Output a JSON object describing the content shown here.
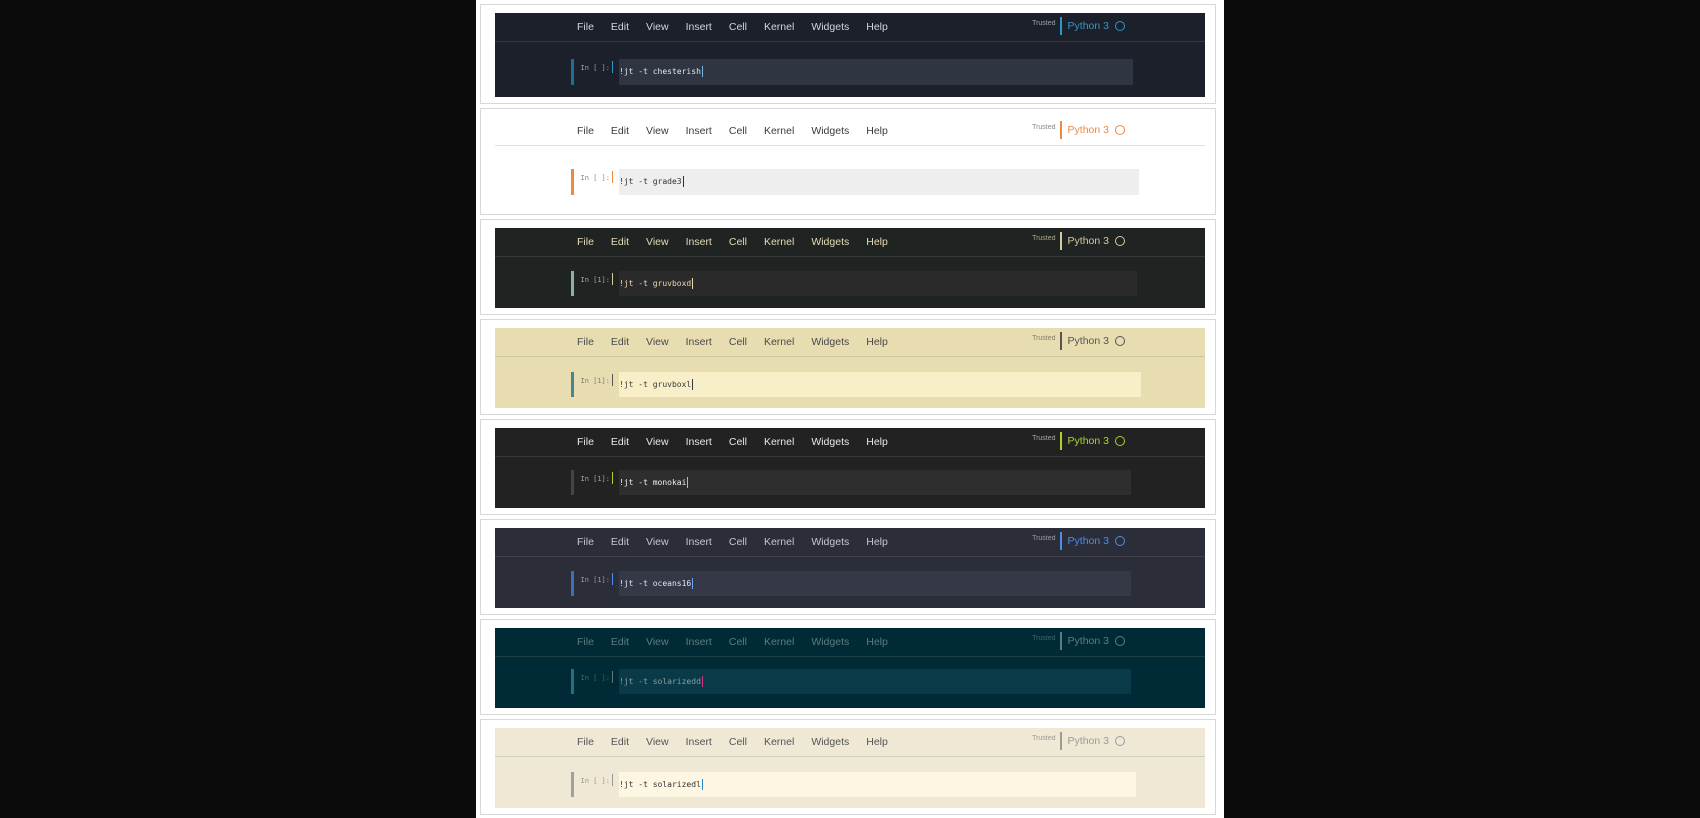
{
  "menu": [
    "File",
    "Edit",
    "View",
    "Insert",
    "Cell",
    "Kernel",
    "Widgets",
    "Help"
  ],
  "trusted_label": "Trusted",
  "kernel_label": "Python 3",
  "themes": [
    {
      "id": "chesterish",
      "prompt": "In [ ]:",
      "command": "!jt -t chesterish",
      "colors": {
        "bg": "#1c202b",
        "cell": "#303542",
        "text": "#d1d5dd",
        "menu": "#d1d5dd",
        "accent": "#2e97c9",
        "border": "#1f6e96",
        "code": "#e2e6ee",
        "cursor": "#6fb8e0"
      }
    },
    {
      "id": "grade3",
      "prompt": "In [ ]:",
      "command": "!jt -t grade3",
      "colors": {
        "bg": "#ffffff",
        "cell": "#eeeeee",
        "text": "#555555",
        "menu": "#3a3a3a",
        "accent": "#f0883e",
        "border": "#f0883e",
        "code": "#303030",
        "cursor": "#303030"
      }
    },
    {
      "id": "gruvboxd",
      "prompt": "In [1]:",
      "command": "!jt -t gruvboxd",
      "colors": {
        "bg": "#1f2422",
        "cell": "#2a2a2a",
        "text": "#e5dcb6",
        "menu": "#e5dcb6",
        "accent": "#d6c99e",
        "border": "#8fb0a0",
        "code": "#ebdbb2",
        "cursor": "#ebdbb2"
      }
    },
    {
      "id": "gruvboxl",
      "prompt": "In [1]:",
      "command": "!jt -t gruvboxl",
      "colors": {
        "bg": "#e8dcb1",
        "cell": "#f8efc8",
        "text": "#5a544a",
        "menu": "#4a4a4a",
        "accent": "#555555",
        "border": "#46878d",
        "code": "#3a3a3a",
        "cursor": "#3a3a3a"
      }
    },
    {
      "id": "monokai",
      "prompt": "In [1]:",
      "command": "!jt -t monokai",
      "colors": {
        "bg": "#222222",
        "cell": "#2e2e2e",
        "text": "#dddddd",
        "menu": "#e8e8e8",
        "accent": "#a6d62c",
        "border": "#444444",
        "code": "#f0f0f0",
        "cursor": "#66d9ef"
      }
    },
    {
      "id": "oceans16",
      "prompt": "In [1]:",
      "command": "!jt -t oceans16",
      "colors": {
        "bg": "#2b2d38",
        "cell": "#353846",
        "text": "#c4c6cf",
        "menu": "#c4c6cf",
        "accent": "#4c8ee8",
        "border": "#3b6fb8",
        "code": "#e4e6ee",
        "cursor": "#6ba6f4"
      }
    },
    {
      "id": "solarizedd",
      "prompt": "In [ ]:",
      "command": "!jt -t solarizedd",
      "colors": {
        "bg": "#002b36",
        "cell": "#0a3a47",
        "text": "#5e7b82",
        "menu": "#5e7b82",
        "accent": "#5e7b82",
        "border": "#286e80",
        "code": "#8a9ea3",
        "cursor": "#d33682"
      }
    },
    {
      "id": "solarizedl",
      "prompt": "In [ ]:",
      "command": "!jt -t solarizedl",
      "colors": {
        "bg": "#eee8d5",
        "cell": "#fdf6e3",
        "text": "#777777",
        "menu": "#555555",
        "accent": "#9a9a9a",
        "border": "#a0a0a0",
        "code": "#333333",
        "cursor": "#268bd2"
      }
    }
  ]
}
